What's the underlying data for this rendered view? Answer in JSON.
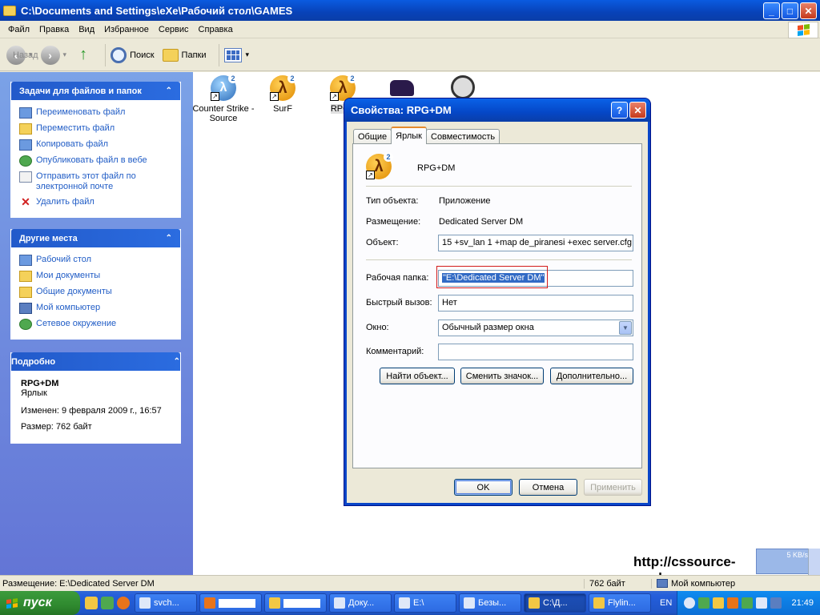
{
  "window": {
    "title": "C:\\Documents and Settings\\eXe\\Рабочий стол\\GAMES",
    "min": "_",
    "max": "□",
    "close": "✕"
  },
  "menu": [
    "Файл",
    "Правка",
    "Вид",
    "Избранное",
    "Сервис",
    "Справка"
  ],
  "toolbar": {
    "back": "Назад",
    "forward_glyph": "›",
    "back_glyph": "‹",
    "up_glyph": "↑",
    "search": "Поиск",
    "folders": "Папки",
    "views_arrow": "▾"
  },
  "left_panel": {
    "tasks": {
      "title": "Задачи для файлов и папок",
      "chevron": "⌃",
      "items": [
        "Переименовать файл",
        "Переместить файл",
        "Копировать файл",
        "Опубликовать файл в вебе",
        "Отправить этот файл по электронной почте",
        "Удалить файл"
      ]
    },
    "places": {
      "title": "Другие места",
      "chevron": "⌃",
      "items": [
        "Рабочий стол",
        "Мои документы",
        "Общие документы",
        "Мой компьютер",
        "Сетевое окружение"
      ]
    },
    "details": {
      "title": "Подробно",
      "chevron": "⌃",
      "name": "RPG+DM",
      "type": "Ярлык",
      "modified": "Изменен: 9 февраля 2009 г., 16:57",
      "size": "Размер: 762 байт"
    }
  },
  "files": [
    {
      "name": "Counter Strike - Source",
      "icon": "cs-source-icon"
    },
    {
      "name": "SurF",
      "icon": "half-life-icon"
    },
    {
      "name": "RPG+",
      "icon": "half-life-icon"
    },
    {
      "name": "",
      "icon": "car-icon"
    },
    {
      "name": "",
      "icon": "wheel-icon"
    }
  ],
  "dialog": {
    "title": "Свойства: RPG+DM",
    "help": "?",
    "close": "✕",
    "tabs": [
      "Общие",
      "Ярлык",
      "Совместимость"
    ],
    "active_tab": "Ярлык",
    "file_name": "RPG+DM",
    "type_label": "Тип объекта:",
    "type_value": "Приложение",
    "location_label": "Размещение:",
    "location_value": "Dedicated Server DM",
    "target_label": "Объект:",
    "target_value": "15 +sv_lan 1 +map de_piranesi  +exec server.cfg",
    "workdir_label": "Рабочая папка:",
    "workdir_value": "\"E:\\Dedicated Server DM\"",
    "hotkey_label": "Быстрый вызов:",
    "hotkey_value": "Нет",
    "window_label": "Окно:",
    "window_value": "Обычный размер окна",
    "comment_label": "Комментарий:",
    "comment_value": "",
    "buttons": {
      "find": "Найти объект...",
      "change_icon": "Сменить значок...",
      "advanced": "Дополнительно...",
      "ok": "OK",
      "cancel": "Отмена",
      "apply": "Применить"
    }
  },
  "watermark": "http://cssource-mods.ucoz.ru",
  "net_speed": "5 KB/s",
  "statusbar": {
    "location": "Размещение: E:\\Dedicated Server DM",
    "size": "762 байт",
    "computer": "Мой компьютер"
  },
  "taskbar": {
    "start": "пуск",
    "buttons": [
      "svch...",
      "",
      "",
      "Доку...",
      "E:\\",
      "Безы...",
      "C:\\Д...",
      "Flylin..."
    ],
    "active_index": 6,
    "lang": "EN",
    "clock": "21:49"
  },
  "colors": {
    "xp_blue": "#0a5be0",
    "link_blue": "#215dc6",
    "selection": "#316ac5",
    "highlight_box": "#d21a1a"
  }
}
